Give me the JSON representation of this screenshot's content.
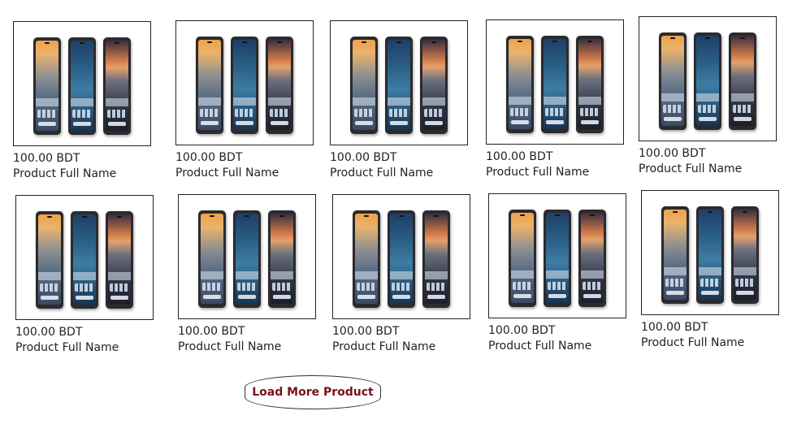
{
  "products": [
    {
      "price": "100.00 BDT",
      "name": "Product Full Name"
    },
    {
      "price": "100.00 BDT",
      "name": "Product Full Name"
    },
    {
      "price": "100.00 BDT",
      "name": "Product Full Name"
    },
    {
      "price": "100.00 BDT",
      "name": "Product Full Name"
    },
    {
      "price": "100.00 BDT",
      "name": "Product Full Name"
    },
    {
      "price": "100.00 BDT",
      "name": "Product Full Name"
    },
    {
      "price": "100.00 BDT",
      "name": "Product Full Name"
    },
    {
      "price": "100.00 BDT",
      "name": "Product Full Name"
    },
    {
      "price": "100.00 BDT",
      "name": "Product Full Name"
    },
    {
      "price": "100.00 BDT",
      "name": "Product Full Name"
    }
  ],
  "load_more_label": "Load More Product"
}
